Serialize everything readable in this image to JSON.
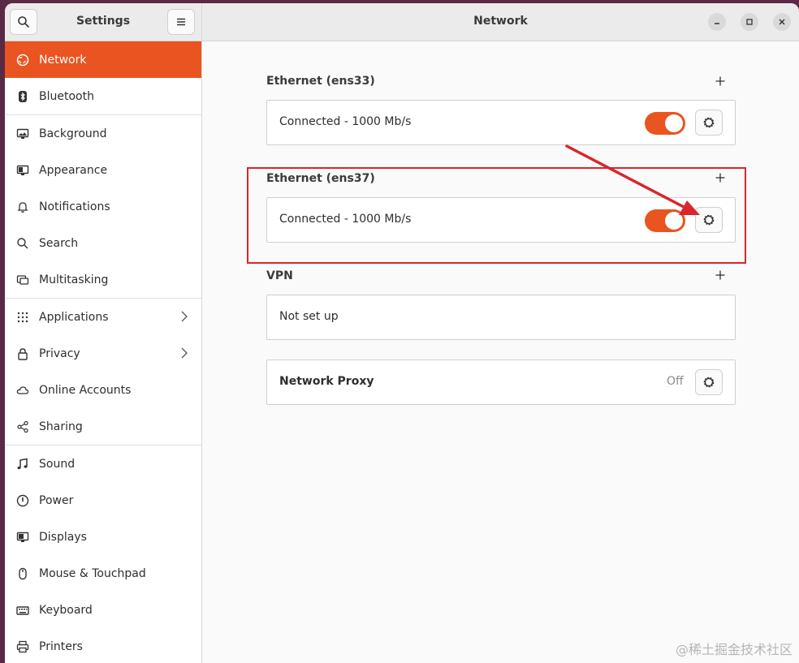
{
  "sidebar": {
    "title": "Settings",
    "items": [
      {
        "label": "Network"
      },
      {
        "label": "Bluetooth"
      },
      {
        "label": "Background"
      },
      {
        "label": "Appearance"
      },
      {
        "label": "Notifications"
      },
      {
        "label": "Search"
      },
      {
        "label": "Multitasking"
      },
      {
        "label": "Applications"
      },
      {
        "label": "Privacy"
      },
      {
        "label": "Online Accounts"
      },
      {
        "label": "Sharing"
      },
      {
        "label": "Sound"
      },
      {
        "label": "Power"
      },
      {
        "label": "Displays"
      },
      {
        "label": "Mouse & Touchpad"
      },
      {
        "label": "Keyboard"
      },
      {
        "label": "Printers"
      }
    ]
  },
  "header": {
    "title": "Network"
  },
  "sections": {
    "ethernet1": {
      "title": "Ethernet (ens33)",
      "status": "Connected - 1000 Mb/s",
      "enabled": true
    },
    "ethernet2": {
      "title": "Ethernet (ens37)",
      "status": "Connected - 1000 Mb/s",
      "enabled": true
    },
    "vpn": {
      "title": "VPN",
      "status": "Not set up"
    },
    "proxy": {
      "label": "Network Proxy",
      "status": "Off"
    }
  },
  "colors": {
    "accent": "#e95420",
    "annotation": "#d9262c"
  },
  "watermark": "@稀土掘金技术社区"
}
